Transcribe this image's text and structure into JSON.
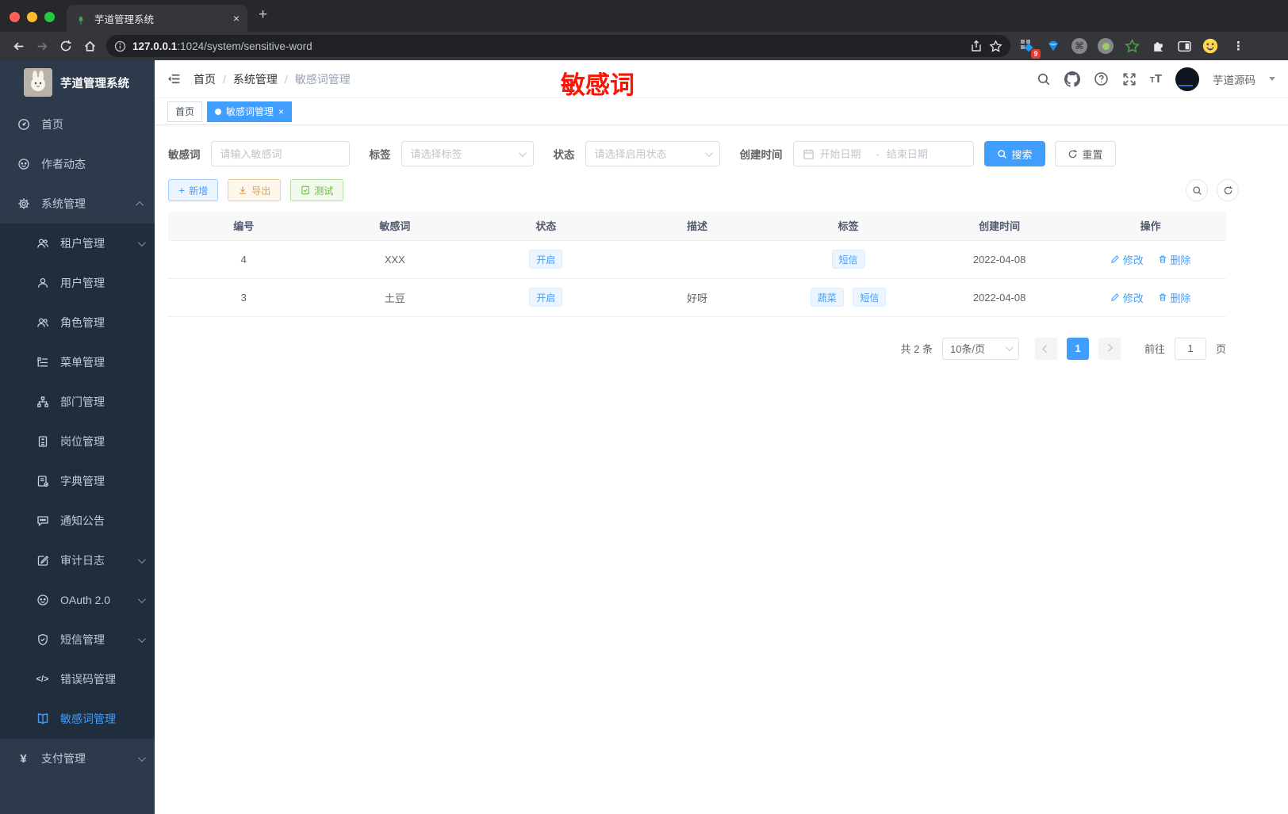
{
  "browser": {
    "tab_title": "芋道管理系统",
    "url_host": "127.0.0.1",
    "url_rest": ":1024/system/sensitive-word",
    "ext_badge": "9"
  },
  "icons": {
    "close": "×",
    "plus": "+",
    "kebab": "⋮",
    "command": "⌘",
    "question": "?",
    "code": "</>",
    "yen": "¥"
  },
  "sidebar": {
    "logo_title": "芋道管理系统",
    "menu": [
      {
        "label": "首页",
        "icon": "dashboard-icon"
      },
      {
        "label": "作者动态",
        "icon": "chat-icon"
      },
      {
        "label": "系统管理",
        "icon": "gear-icon",
        "state": "expanded"
      },
      {
        "label": "租户管理",
        "icon": "users-icon",
        "state": "collapsed"
      },
      {
        "label": "用户管理",
        "icon": "user-icon"
      },
      {
        "label": "角色管理",
        "icon": "users-icon"
      },
      {
        "label": "菜单管理",
        "icon": "menu-tree-icon"
      },
      {
        "label": "部门管理",
        "icon": "org-icon"
      },
      {
        "label": "岗位管理",
        "icon": "badge-icon"
      },
      {
        "label": "字典管理",
        "icon": "dictionary-icon"
      },
      {
        "label": "通知公告",
        "icon": "announcement-icon"
      },
      {
        "label": "审计日志",
        "icon": "audit-log-icon",
        "state": "collapsed"
      },
      {
        "label": "OAuth 2.0",
        "icon": "robot-icon",
        "state": "collapsed"
      },
      {
        "label": "短信管理",
        "icon": "shield-icon",
        "state": "collapsed"
      },
      {
        "label": "错误码管理",
        "icon": "code-icon"
      },
      {
        "label": "敏感词管理",
        "icon": "open-book-icon",
        "state": "active"
      },
      {
        "label": "支付管理",
        "icon": "yen-icon",
        "state": "collapsed"
      }
    ]
  },
  "header": {
    "breadcrumb": [
      "首页",
      "系统管理",
      "敏感词管理"
    ],
    "annotation": "敏感词",
    "username": "芋道源码"
  },
  "tags_view": {
    "tabs": [
      {
        "label": "首页",
        "active": false
      },
      {
        "label": "敏感词管理",
        "active": true
      }
    ]
  },
  "filters": {
    "keyword": {
      "label": "敏感词",
      "placeholder": "请输入敏感词",
      "value": ""
    },
    "tag": {
      "label": "标签",
      "placeholder": "请选择标签",
      "value": ""
    },
    "status": {
      "label": "状态",
      "placeholder": "请选择启用状态",
      "value": ""
    },
    "time": {
      "label": "创建时间",
      "start_placeholder": "开始日期",
      "separator": "-",
      "end_placeholder": "结束日期"
    },
    "search_label": "搜索",
    "reset_label": "重置"
  },
  "toolbar": {
    "add_label": "新增",
    "export_label": "导出",
    "test_label": "测试"
  },
  "table": {
    "columns": [
      "编号",
      "敏感词",
      "状态",
      "描述",
      "标签",
      "创建时间",
      "操作"
    ],
    "rows": [
      {
        "id": "4",
        "word": "XXX",
        "status": "开启",
        "description": "",
        "tags": [
          "短信"
        ],
        "create_time": "2022-04-08"
      },
      {
        "id": "3",
        "word": "土豆",
        "status": "开启",
        "description": "好呀",
        "tags": [
          "蔬菜",
          "短信"
        ],
        "create_time": "2022-04-08"
      }
    ],
    "edit_label": "修改",
    "delete_label": "删除"
  },
  "pagination": {
    "total_text": "共 2 条",
    "page_size_text": "10条/页",
    "current_page": "1",
    "goto_label": "前往",
    "goto_value": "1",
    "page_unit": "页"
  },
  "colors": {
    "primary": "#409eff",
    "annotation_red": "#fb1504",
    "sidebar_bg": "#2d3a4b",
    "submenu_bg": "#1f2d3d",
    "tag_bg": "#ecf5ff",
    "warning": "#e6a23c",
    "success": "#67c23a"
  }
}
